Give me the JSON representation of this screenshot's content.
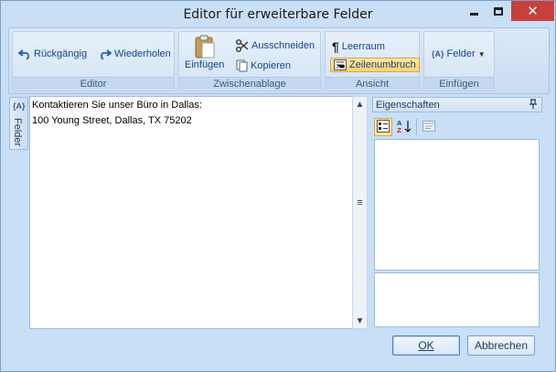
{
  "window": {
    "title": "Editor für erweiterbare Felder",
    "close_glyph": "✕"
  },
  "ribbon": {
    "groups": [
      {
        "label": "Editor"
      },
      {
        "label": "Zwischenablage"
      },
      {
        "label": "Ansicht"
      },
      {
        "label": "Einfügen"
      }
    ],
    "undo_label": "Rückgängig",
    "redo_label": "Wiederholen",
    "paste_label": "Einfügen",
    "cut_label": "Ausschneiden",
    "copy_label": "Kopieren",
    "whitespace_label": "Leerraum",
    "wordwrap_label": "Zeilenumbruch",
    "fields_label": "Felder"
  },
  "sidetab": {
    "icon_text": "{A}",
    "label": "Felder"
  },
  "editor": {
    "line1": "Kontaktieren Sie unser Büro in Dallas:",
    "line2": "100 Young Street, Dallas, TX 75202"
  },
  "properties": {
    "title": "Eigenschaften"
  },
  "buttons": {
    "ok_label": "OK",
    "cancel_label": "Abbrechen"
  },
  "colors": {
    "chrome": "#c8dff5",
    "accent_active": "#ffd26a",
    "close": "#c7403a"
  }
}
